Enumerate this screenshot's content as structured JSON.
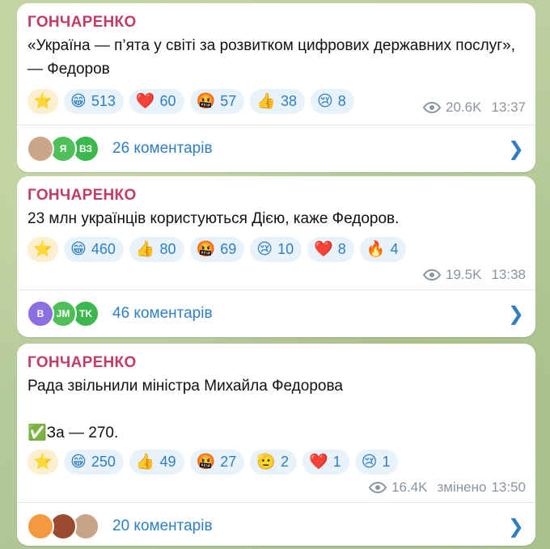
{
  "posts": [
    {
      "author": "ГОНЧАРЕНКО",
      "text": "«Україна — п’ята у світі за розвитком цифрових державних послуг», — Федоров",
      "reactions": [
        {
          "emoji": "⭐",
          "count": ""
        },
        {
          "emoji": "😁",
          "count": "513"
        },
        {
          "emoji": "❤️",
          "count": "60"
        },
        {
          "emoji": "🤬",
          "count": "57"
        },
        {
          "emoji": "👍",
          "count": "38"
        },
        {
          "emoji": "😢",
          "count": "8"
        }
      ],
      "views": "20.6K",
      "time": "13:37",
      "avatars": [
        {
          "label": "",
          "color": "#c9a58a"
        },
        {
          "label": "Я",
          "color": "#4fbf5a"
        },
        {
          "label": "ВЗ",
          "color": "#3cb84f"
        }
      ],
      "comments_label": "26 коментарів"
    },
    {
      "author": "ГОНЧАРЕНКО",
      "text": "23 млн українців користуються Дією, каже Федоров.",
      "reactions": [
        {
          "emoji": "⭐",
          "count": ""
        },
        {
          "emoji": "😁",
          "count": "460"
        },
        {
          "emoji": "👍",
          "count": "80"
        },
        {
          "emoji": "🤬",
          "count": "69"
        },
        {
          "emoji": "😢",
          "count": "10"
        },
        {
          "emoji": "❤️",
          "count": "8"
        },
        {
          "emoji": "🔥",
          "count": "4"
        }
      ],
      "views": "19.5K",
      "time": "13:38",
      "avatars": [
        {
          "label": "В",
          "color": "#8c6fe0"
        },
        {
          "label": "JM",
          "color": "#4fbf5a"
        },
        {
          "label": "TK",
          "color": "#3cb84f"
        }
      ],
      "comments_label": "46 коментарів"
    },
    {
      "author": "ГОНЧАРЕНКО",
      "text": "Рада звільнили міністра Михайла Федорова\n\n✅За — 270.",
      "reactions": [
        {
          "emoji": "⭐",
          "count": ""
        },
        {
          "emoji": "😁",
          "count": "250"
        },
        {
          "emoji": "👍",
          "count": "49"
        },
        {
          "emoji": "🤬",
          "count": "27"
        },
        {
          "emoji": "🫡",
          "count": "2"
        },
        {
          "emoji": "❤️",
          "count": "1"
        },
        {
          "emoji": "😢",
          "count": "1"
        }
      ],
      "views": "16.4K",
      "edited_label": "змінено",
      "time": "13:50",
      "avatars": [
        {
          "label": "",
          "color": "#f39a3e"
        },
        {
          "label": "",
          "color": "#9a4b2f"
        },
        {
          "label": "",
          "color": "#c8a38a"
        }
      ],
      "comments_label": "20 коментарів"
    }
  ],
  "colors": {
    "author": "#c03d63",
    "link": "#2f7fc0",
    "reaction_bg": "#e8f2fb",
    "star_bg": "#fbefd0",
    "meta": "#8a959e"
  },
  "icons": {
    "views": "eye-icon",
    "open": "chevron-right-icon"
  }
}
